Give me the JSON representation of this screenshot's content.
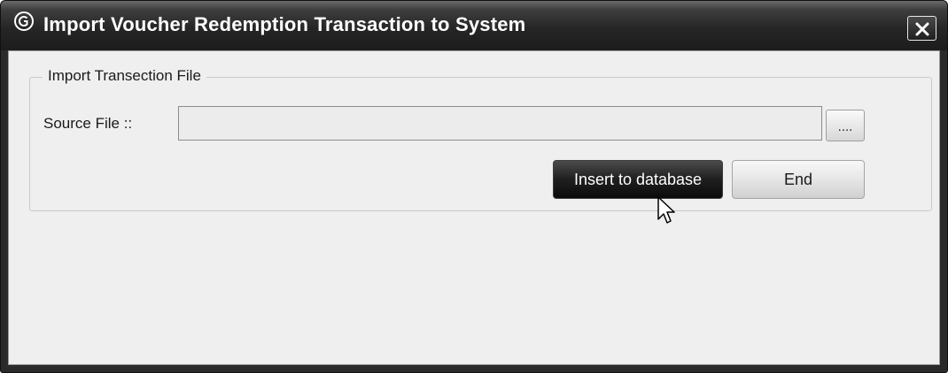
{
  "window": {
    "title": "Import Voucher Redemption Transaction to System",
    "icon": "app-logo-icon",
    "close_icon": "close-icon"
  },
  "group": {
    "legend": "Import Transection File",
    "source_label": "Source File ::",
    "source_value": "",
    "browse_label": "....",
    "insert_label": "Insert to database",
    "end_label": "End"
  },
  "colors": {
    "titlebar": "#1c1c1c",
    "client_background": "#efefef",
    "primary_button": "#1a1a1a",
    "secondary_button": "#e6e6e6"
  },
  "cursor": {
    "icon": "mouse-pointer-icon",
    "hovering": "insert-to-database-button"
  }
}
